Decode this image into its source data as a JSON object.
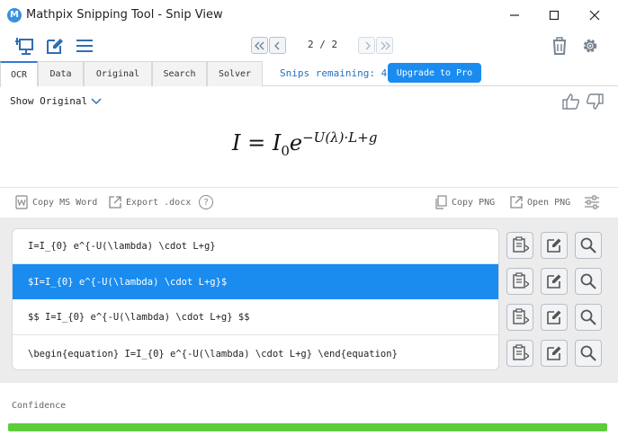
{
  "window": {
    "logo_letter": "M",
    "title": "Mathpix Snipping Tool - Snip View"
  },
  "toolbar": {
    "page_indicator": "2 / 2"
  },
  "tabs": [
    {
      "label": "OCR"
    },
    {
      "label": "Data"
    },
    {
      "label": "Original"
    },
    {
      "label": "Search"
    },
    {
      "label": "Solver"
    }
  ],
  "active_tab": "OCR",
  "snips_remaining": "Snips remaining: 48",
  "upgrade_label": "Upgrade to Pro",
  "preview": {
    "show_original_label": "Show Original",
    "formula": {
      "lhs": "I",
      "eq": "=",
      "base": "I",
      "subscript": "0",
      "e": "e",
      "exponent": "−U(λ)·L+g"
    }
  },
  "actions": {
    "copy_ms_word": "Copy MS Word",
    "export_docx": "Export .docx",
    "help": "?",
    "copy_png": "Copy PNG",
    "open_png": "Open PNG"
  },
  "results": [
    {
      "text": "I=I_{0} e^{-U(\\lambda) \\cdot L+g}",
      "selected": false
    },
    {
      "text": "$I=I_{0} e^{-U(\\lambda) \\cdot L+g}$",
      "selected": true
    },
    {
      "text": "$$  I=I_{0} e^{-U(\\lambda) \\cdot L+g}  $$",
      "selected": false
    },
    {
      "text": "\\begin{equation}  I=I_{0} e^{-U(\\lambda) \\cdot L+g}  \\end{equation}",
      "selected": false
    }
  ],
  "confidence": {
    "label": "Confidence",
    "value": 1.0
  },
  "colors": {
    "accent": "#1a8cf0",
    "confidence_bar": "#5dcc3a"
  }
}
